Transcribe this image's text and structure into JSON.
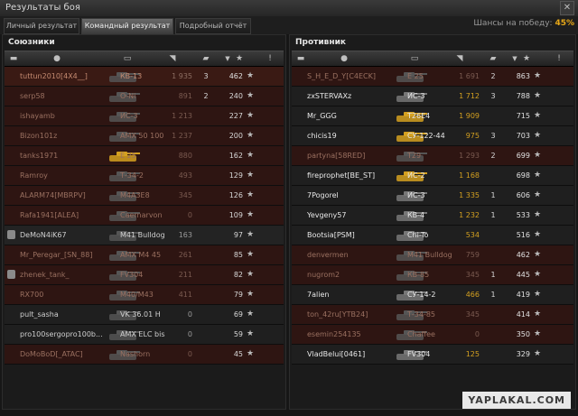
{
  "window": {
    "title": "Результаты боя"
  },
  "tabs": [
    {
      "label": "Личный результат",
      "active": false
    },
    {
      "label": "Командный результат",
      "active": true
    },
    {
      "label": "Подробный отчёт",
      "active": false
    }
  ],
  "chance": {
    "label": "Шансы на победу:",
    "value": "45%"
  },
  "allies": {
    "title": "Союзники",
    "rows": [
      {
        "name": "tuttun2010[4X4__]",
        "tank": "КВ-13",
        "dmg": "1 935",
        "kills": "3",
        "xp": "462",
        "dead": true,
        "bg": "#3a1a14",
        "nc": "#c48a70",
        "tankc": "#c48a70",
        "dc": "#8d6e62",
        "xpc": "#e0e0e0",
        "tcol": "#555"
      },
      {
        "name": "serp58",
        "tank": "О-Ni",
        "dmg": "891",
        "kills": "2",
        "xp": "240",
        "dead": true,
        "bg": "#2e1512",
        "nc": "#9a7060",
        "tankc": "#9a7060",
        "dc": "#7a5a50",
        "xpc": "#d8d8d8",
        "tcol": "#555"
      },
      {
        "name": "ishayamb",
        "tank": "ИС-3",
        "dmg": "1 213",
        "kills": "",
        "xp": "227",
        "dead": true,
        "bg": "#2e1512",
        "nc": "#9a7060",
        "tankc": "#9a7060",
        "dc": "#7a5a50",
        "xpc": "#d8d8d8",
        "tcol": "#555"
      },
      {
        "name": "Bizon101z",
        "tank": "AMX 50 100",
        "dmg": "1 237",
        "kills": "",
        "xp": "200",
        "dead": true,
        "bg": "#2e1512",
        "nc": "#9a7060",
        "tankc": "#9a7060",
        "dc": "#7a5a50",
        "xpc": "#d8d8d8",
        "tcol": "#555"
      },
      {
        "name": "tanks1971",
        "tank": "E 25",
        "dmg": "880",
        "kills": "",
        "xp": "162",
        "dead": true,
        "bg": "#2e1512",
        "nc": "#9a7060",
        "tankc": "#9a7060",
        "dc": "#7a5a50",
        "xpc": "#d8d8d8",
        "tcol": "#d4a020"
      },
      {
        "name": "Ramroy",
        "tank": "Т-34-2",
        "dmg": "493",
        "kills": "",
        "xp": "129",
        "dead": true,
        "bg": "#2e1512",
        "nc": "#9a7060",
        "tankc": "#9a7060",
        "dc": "#7a5a50",
        "xpc": "#d8d8d8",
        "tcol": "#555"
      },
      {
        "name": "ALARM74[MBRPV]",
        "tank": "M4A3E8",
        "dmg": "345",
        "kills": "",
        "xp": "126",
        "dead": true,
        "bg": "#2e1512",
        "nc": "#9a7060",
        "tankc": "#9a7060",
        "dc": "#7a5a50",
        "xpc": "#d8d8d8",
        "tcol": "#555"
      },
      {
        "name": "Rafa1941[ALEA]",
        "tank": "Caernarvon",
        "dmg": "0",
        "kills": "",
        "xp": "109",
        "dead": true,
        "bg": "#2e1512",
        "nc": "#9a7060",
        "tankc": "#9a7060",
        "dc": "#7a5a50",
        "xpc": "#d8d8d8",
        "tcol": "#555"
      },
      {
        "name": "DeMoN4iK67",
        "tank": "M41 Bulldog",
        "dmg": "163",
        "kills": "",
        "xp": "97",
        "dead": false,
        "sq": true,
        "bg": "#232323",
        "nc": "#cfcfcf",
        "tankc": "#cfcfcf",
        "dc": "#9a9a9a",
        "xpc": "#d8d8d8",
        "tcol": "#555"
      },
      {
        "name": "Mr_Peregar_[SN_88]",
        "tank": "AMX M4 45",
        "dmg": "261",
        "kills": "",
        "xp": "85",
        "dead": true,
        "bg": "#2e1512",
        "nc": "#9a7060",
        "tankc": "#9a7060",
        "dc": "#7a5a50",
        "xpc": "#d8d8d8",
        "tcol": "#555"
      },
      {
        "name": "zhenek_tank_",
        "tank": "FV304",
        "dmg": "211",
        "kills": "",
        "xp": "82",
        "dead": true,
        "sq": true,
        "bg": "#2e1512",
        "nc": "#9a7060",
        "tankc": "#9a7060",
        "dc": "#7a5a50",
        "xpc": "#d8d8d8",
        "tcol": "#555"
      },
      {
        "name": "RX700",
        "tank": "M40/M43",
        "dmg": "411",
        "kills": "",
        "xp": "79",
        "dead": true,
        "bg": "#2e1512",
        "nc": "#9a7060",
        "tankc": "#9a7060",
        "dc": "#7a5a50",
        "xpc": "#d8d8d8",
        "tcol": "#555"
      },
      {
        "name": "pult_sasha",
        "tank": "VK 36.01 H",
        "dmg": "0",
        "kills": "",
        "xp": "69",
        "dead": false,
        "bg": "#1f1f1f",
        "nc": "#cfcfcf",
        "tankc": "#cfcfcf",
        "dc": "#9a9a9a",
        "xpc": "#d8d8d8",
        "tcol": "#555"
      },
      {
        "name": "pro100sergopro100b...",
        "tank": "AMX ELC bis",
        "dmg": "0",
        "kills": "",
        "xp": "59",
        "dead": false,
        "bg": "#1f1f1f",
        "nc": "#cfcfcf",
        "tankc": "#cfcfcf",
        "dc": "#9a9a9a",
        "xpc": "#d8d8d8",
        "tcol": "#555"
      },
      {
        "name": "DoMoBoD[_ATAC]",
        "tank": "Nashorn",
        "dmg": "0",
        "kills": "",
        "xp": "45",
        "dead": true,
        "bg": "#2e1512",
        "nc": "#9a7060",
        "tankc": "#9a7060",
        "dc": "#7a5a50",
        "xpc": "#d8d8d8",
        "tcol": "#555"
      }
    ]
  },
  "enemies": {
    "title": "Противник",
    "rows": [
      {
        "name": "S_H_E_D_Y[C4ECK]",
        "tank": "E 25",
        "dmg": "1 691",
        "kills": "2",
        "xp": "863",
        "dead": true,
        "bg": "#2e1512",
        "nc": "#9a7060",
        "tankc": "#9a7060",
        "dc": "#7a5a50",
        "xpc": "#e0e0e0",
        "tcol": "#555"
      },
      {
        "name": "zxSTERVAXz",
        "tank": "ИС-3",
        "dmg": "1 712",
        "kills": "3",
        "xp": "788",
        "dead": false,
        "bg": "#1f1f1f",
        "nc": "#e8e8e8",
        "tankc": "#e8e8e8",
        "dc": "#d4a020",
        "xpc": "#e0e0e0",
        "tcol": "#777"
      },
      {
        "name": "Mr_GGG",
        "tank": "T26E4",
        "dmg": "1 909",
        "kills": "",
        "xp": "715",
        "dead": false,
        "bg": "#1f1f1f",
        "nc": "#e8e8e8",
        "tankc": "#e8e8e8",
        "dc": "#d4a020",
        "xpc": "#e0e0e0",
        "tcol": "#d4a020"
      },
      {
        "name": "chicis19",
        "tank": "СУ-122-44",
        "dmg": "975",
        "kills": "3",
        "xp": "703",
        "dead": false,
        "bg": "#1f1f1f",
        "nc": "#e8e8e8",
        "tankc": "#e8e8e8",
        "dc": "#d4a020",
        "xpc": "#e0e0e0",
        "tcol": "#d4a020"
      },
      {
        "name": "partyna[58RED]",
        "tank": "T29",
        "dmg": "1 293",
        "kills": "2",
        "xp": "699",
        "dead": true,
        "bg": "#2e1512",
        "nc": "#9a7060",
        "tankc": "#9a7060",
        "dc": "#7a5a50",
        "xpc": "#e0e0e0",
        "tcol": "#555"
      },
      {
        "name": "fireprophet[BE_ST]",
        "tank": "ИС-2",
        "dmg": "1 168",
        "kills": "",
        "xp": "698",
        "dead": false,
        "bg": "#1f1f1f",
        "nc": "#e8e8e8",
        "tankc": "#e8e8e8",
        "dc": "#d4a020",
        "xpc": "#e0e0e0",
        "tcol": "#d4a020"
      },
      {
        "name": "7Pogorel",
        "tank": "ИС-3",
        "dmg": "1 335",
        "kills": "1",
        "xp": "606",
        "dead": false,
        "bg": "#1f1f1f",
        "nc": "#e8e8e8",
        "tankc": "#e8e8e8",
        "dc": "#d4a020",
        "xpc": "#e0e0e0",
        "tcol": "#777"
      },
      {
        "name": "Yevgeny57",
        "tank": "КВ-4",
        "dmg": "1 232",
        "kills": "1",
        "xp": "533",
        "dead": false,
        "bg": "#1f1f1f",
        "nc": "#e8e8e8",
        "tankc": "#e8e8e8",
        "dc": "#d4a020",
        "xpc": "#e0e0e0",
        "tcol": "#777"
      },
      {
        "name": "Bootsia[PSM]",
        "tank": "Chi-To",
        "dmg": "534",
        "kills": "",
        "xp": "516",
        "dead": false,
        "bg": "#1f1f1f",
        "nc": "#e8e8e8",
        "tankc": "#e8e8e8",
        "dc": "#d4a020",
        "xpc": "#e0e0e0",
        "tcol": "#777"
      },
      {
        "name": "denvermen",
        "tank": "M41 Bulldog",
        "dmg": "759",
        "kills": "",
        "xp": "462",
        "dead": true,
        "bg": "#2e1512",
        "nc": "#9a7060",
        "tankc": "#9a7060",
        "dc": "#7a5a50",
        "xpc": "#e0e0e0",
        "tcol": "#555"
      },
      {
        "name": "nugrom2",
        "tank": "КВ-85",
        "dmg": "345",
        "kills": "1",
        "xp": "445",
        "dead": true,
        "bg": "#2e1512",
        "nc": "#9a7060",
        "tankc": "#9a7060",
        "dc": "#7a5a50",
        "xpc": "#e0e0e0",
        "tcol": "#555"
      },
      {
        "name": "7alien",
        "tank": "СУ-14-2",
        "dmg": "466",
        "kills": "1",
        "xp": "419",
        "dead": false,
        "bg": "#1f1f1f",
        "nc": "#e8e8e8",
        "tankc": "#e8e8e8",
        "dc": "#d4a020",
        "xpc": "#e0e0e0",
        "tcol": "#777"
      },
      {
        "name": "ton_42ru[YTB24]",
        "tank": "Т-34-85",
        "dmg": "345",
        "kills": "",
        "xp": "414",
        "dead": true,
        "bg": "#2e1512",
        "nc": "#9a7060",
        "tankc": "#9a7060",
        "dc": "#7a5a50",
        "xpc": "#e0e0e0",
        "tcol": "#555"
      },
      {
        "name": "esemin254135",
        "tank": "Chaffee",
        "dmg": "0",
        "kills": "",
        "xp": "350",
        "dead": true,
        "bg": "#2e1512",
        "nc": "#9a7060",
        "tankc": "#9a7060",
        "dc": "#7a5a50",
        "xpc": "#e0e0e0",
        "tcol": "#555"
      },
      {
        "name": "VladBelui[0461]",
        "tank": "FV304",
        "dmg": "125",
        "kills": "",
        "xp": "329",
        "dead": false,
        "bg": "#1f1f1f",
        "nc": "#e8e8e8",
        "tankc": "#e8e8e8",
        "dc": "#d4a020",
        "xpc": "#e0e0e0",
        "tcol": "#777"
      }
    ]
  },
  "watermark": "YAPLAKAL.COM"
}
